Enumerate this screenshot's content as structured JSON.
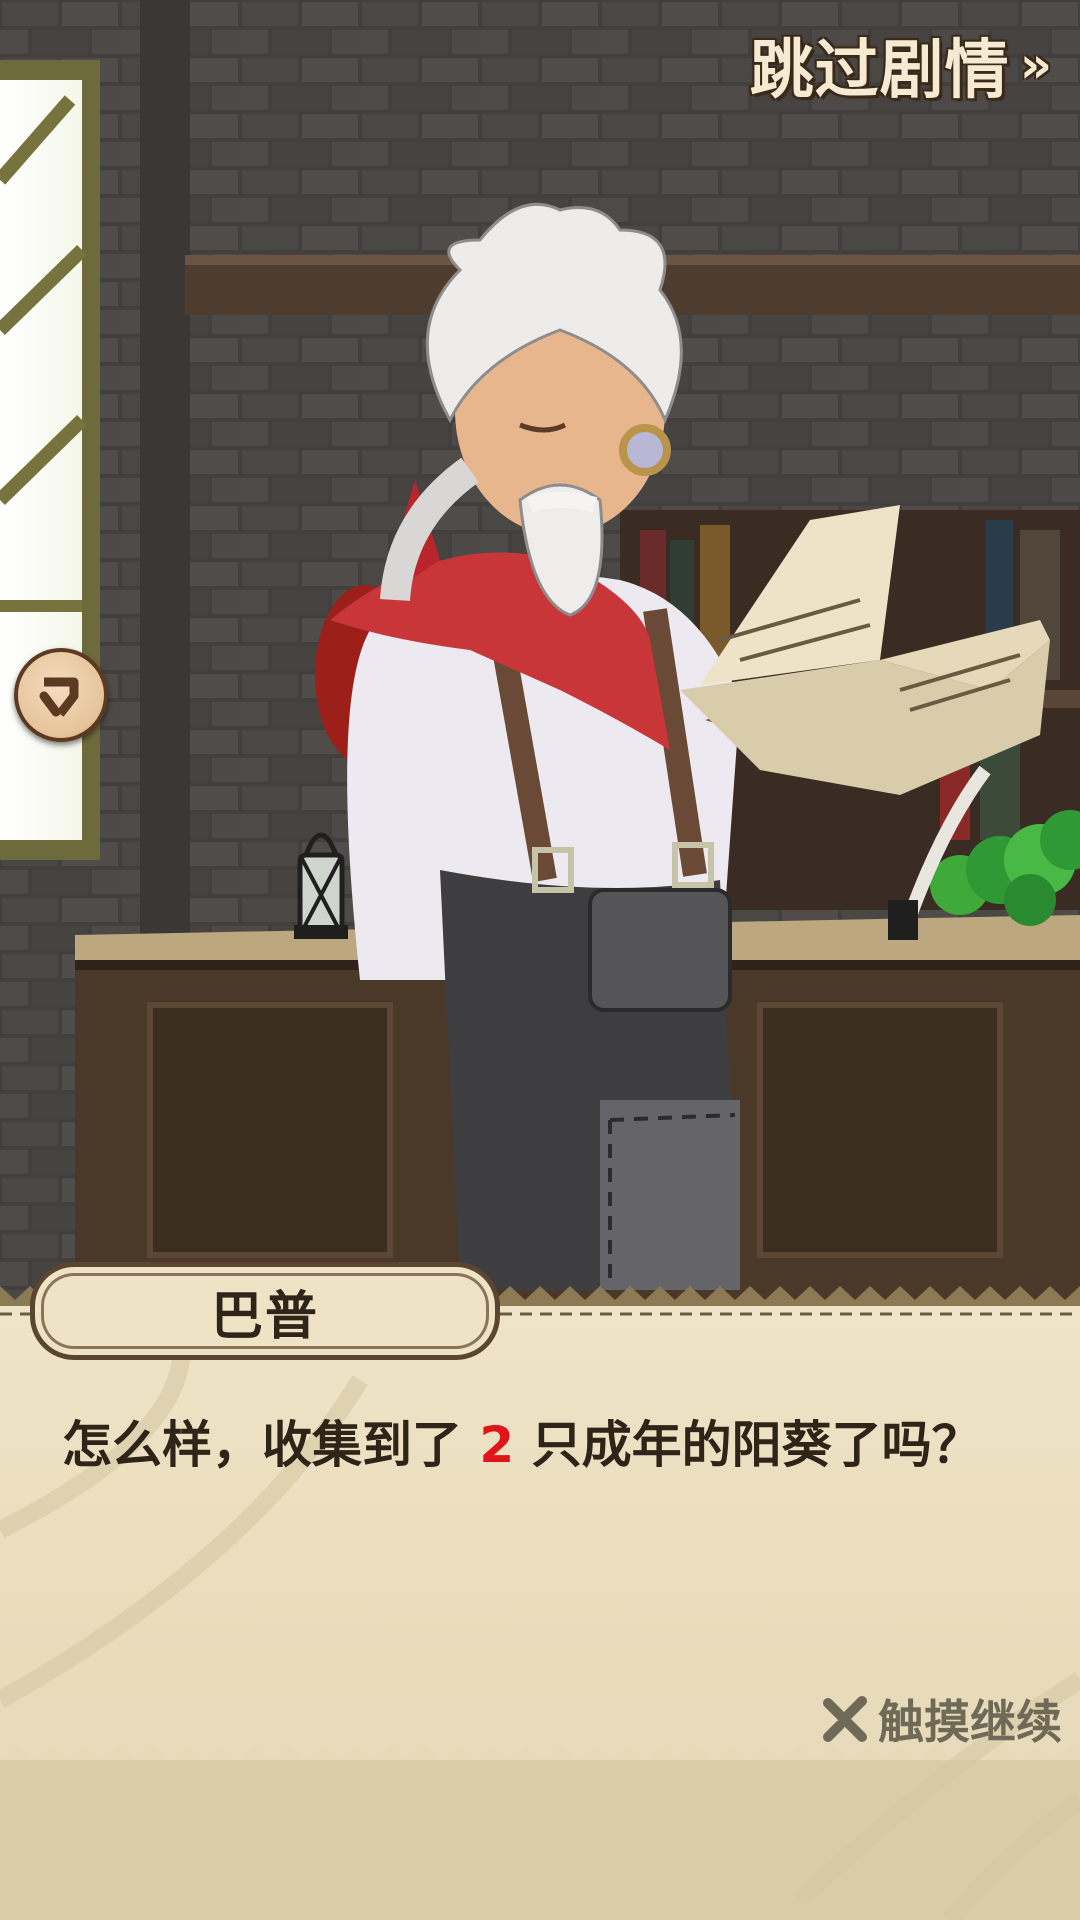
{
  "skip": {
    "label": "跳过剧情",
    "arrow": "»"
  },
  "side_button": {
    "icon": "return-arrow-icon"
  },
  "speaker": {
    "name": "巴普"
  },
  "dialog": {
    "before": "怎么样，收集到了 ",
    "highlight": "2",
    "after": " 只成年的阳葵了吗？",
    "highlight_color": "#e0141a"
  },
  "continue_hint": {
    "label": "触摸继续",
    "icon": "crossed-tools-icon"
  },
  "colors": {
    "wall": "#4a4745",
    "panel": "#e9dcbd",
    "text": "#2e2418"
  }
}
